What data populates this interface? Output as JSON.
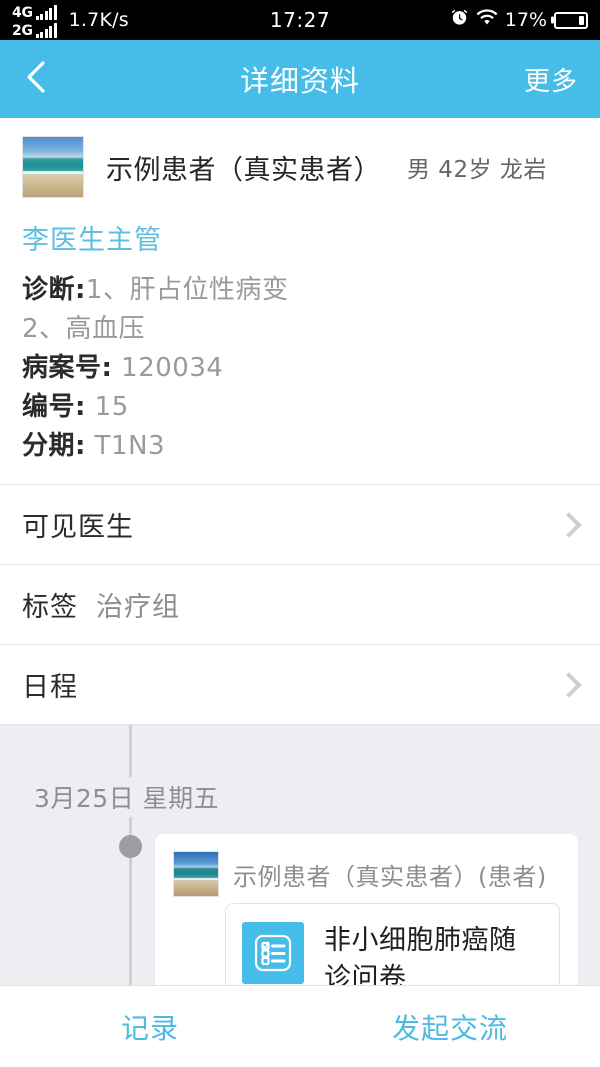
{
  "status_bar": {
    "sim1_network": "4G",
    "sim2_network": "2G",
    "network_speed": "1.7K/s",
    "time": "17:27",
    "battery_percent": "17%",
    "alarm_icon": "alarm-clock-icon",
    "wifi_icon": "wifi-icon",
    "battery_icon": "battery-icon"
  },
  "nav": {
    "back_icon": "chevron-left-icon",
    "title": "详细资料",
    "more_label": "更多"
  },
  "patient": {
    "avatar_icon": "beach-photo-avatar",
    "name": "示例患者（真实患者）",
    "meta": "男 42岁 龙岩",
    "doctor": "李医生主管",
    "info": [
      {
        "key": "诊断:",
        "value": "1、肝占位性病变"
      },
      {
        "key": "",
        "value": "2、高血压"
      },
      {
        "key": "病案号:",
        "value": "120034"
      },
      {
        "key": "编号:",
        "value": "15"
      },
      {
        "key": "分期:",
        "value": "T1N3"
      }
    ]
  },
  "rows": [
    {
      "label": "可见医生",
      "value": "",
      "chevron": true
    },
    {
      "label": "标签",
      "value": "治疗组",
      "chevron": false
    },
    {
      "label": "日程",
      "value": "",
      "chevron": true
    }
  ],
  "timeline": {
    "date": "3月25日 星期五",
    "card": {
      "avatar_icon": "beach-photo-avatar",
      "author": "示例患者（真实患者）(患者)",
      "questionnaire": {
        "icon": "checklist-form-icon",
        "title": "非小细胞肺癌随诊问卷"
      }
    }
  },
  "bottom_bar": {
    "items": [
      {
        "label": "记录"
      },
      {
        "label": "发起交流"
      }
    ]
  },
  "colors": {
    "accent": "#45BDE8",
    "link": "#5DBEDF",
    "timeline_bg": "#EEEEF2",
    "text_primary": "#2B2B2B",
    "text_secondary": "#9A9A9A"
  }
}
